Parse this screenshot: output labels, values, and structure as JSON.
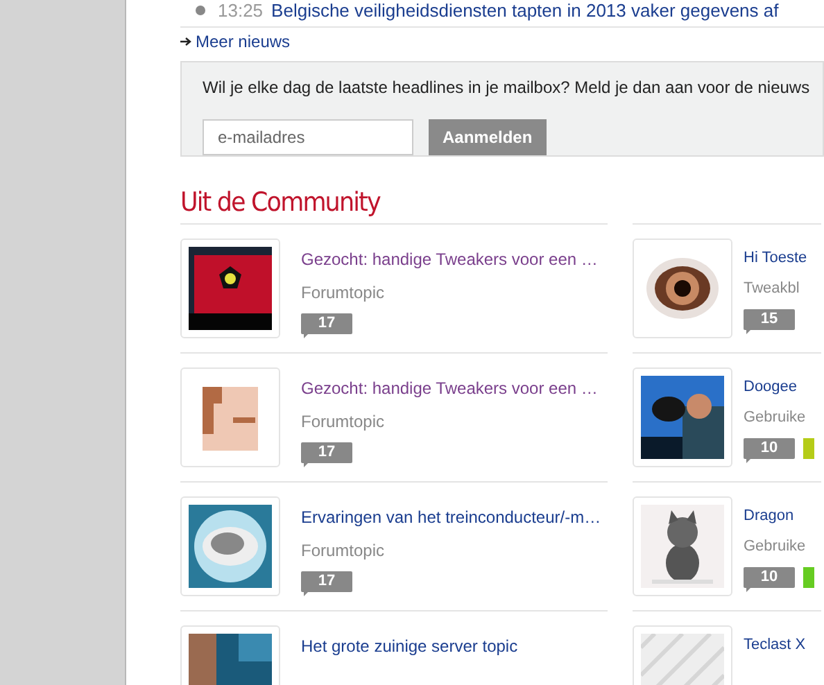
{
  "news_item": {
    "time": "13:25",
    "headline": "Belgische veiligheidsdiensten tapten in 2013 vaker gegevens af"
  },
  "more_link": "Meer nieuws",
  "newsletter": {
    "text": "Wil je elke dag de laatste headlines in je mailbox? Meld je dan aan voor de nieuws",
    "email": {
      "placeholder": "e-mailadres"
    },
    "button": "Aanmelden"
  },
  "community": {
    "title": "Uit de Community",
    "columns": [
      [
        {
          "title": "Gezocht: handige Tweakers voor een …",
          "visited": true,
          "type": "Forumtopic",
          "count": "17"
        },
        {
          "title": "Gezocht: handige Tweakers voor een …",
          "visited": true,
          "type": "Forumtopic",
          "count": "17"
        },
        {
          "title": "Ervaringen van het treinconducteur/-m…",
          "visited": false,
          "type": "Forumtopic",
          "count": "17"
        },
        {
          "title": "Het grote zuinige server topic",
          "visited": false
        }
      ],
      [
        {
          "title": "Hi Toeste",
          "visited": false,
          "type": "Tweakbl",
          "count": "15"
        },
        {
          "title": "Doogee",
          "visited": false,
          "type": "Gebruike",
          "count": "10",
          "color": "#b5cc18"
        },
        {
          "title": "Dragon",
          "visited": false,
          "type": "Gebruike",
          "count": "10",
          "color": "#66cc22"
        },
        {
          "title": "Teclast X",
          "visited": false
        }
      ]
    ]
  }
}
